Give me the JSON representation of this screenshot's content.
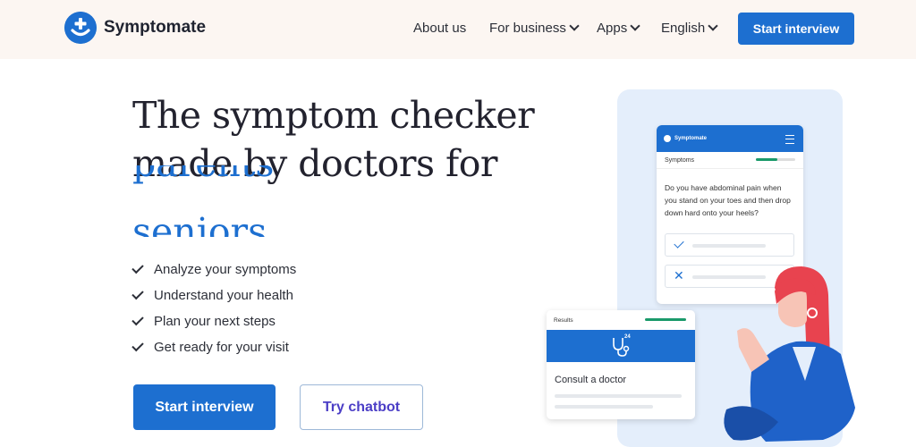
{
  "header": {
    "brand": "Symptomate",
    "nav": [
      {
        "label": "About us",
        "dropdown": false
      },
      {
        "label": "For business",
        "dropdown": true
      },
      {
        "label": "Apps",
        "dropdown": true
      },
      {
        "label": "English",
        "dropdown": true
      }
    ],
    "cta": "Start interview"
  },
  "hero": {
    "headline_line1": "The symptom checker",
    "headline_line2": "made by doctors for",
    "rotating_words": [
      "parents",
      "seniors"
    ],
    "checklist": [
      "Analyze your symptoms",
      "Understand your health",
      "Plan your next steps",
      "Get ready for your visit"
    ],
    "primary_button": "Start interview",
    "secondary_button": "Try chatbot"
  },
  "illustration": {
    "phone_brand": "Symptomate",
    "phone_section": "Symptoms",
    "progress": 0.55,
    "question": "Do you have abdominal pain when you stand on your toes and then drop down hard onto your heels?",
    "results_label": "Results",
    "results_badge": "24",
    "results_text": "Consult a doctor"
  },
  "colors": {
    "brand_blue": "#1d6fd0",
    "header_bg": "#fcf6f2",
    "illustration_bg": "#e4eefb",
    "progress_green": "#1a9a6a",
    "chatbot_text": "#4b3ec6",
    "accent_red": "#e8434f"
  }
}
